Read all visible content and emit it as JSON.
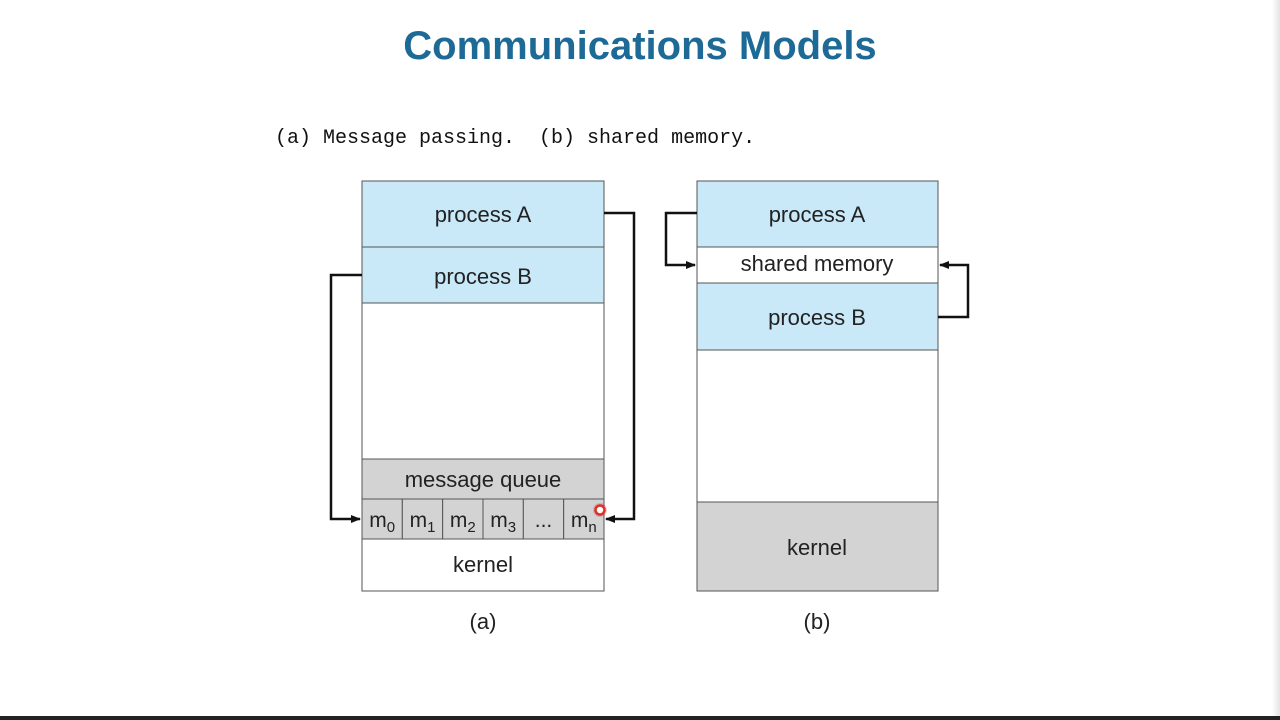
{
  "slide": {
    "title": "Communications Models",
    "subtitle": "(a) Message passing.  (b) shared memory."
  },
  "diagram_a": {
    "caption": "(a)",
    "process_a": "process A",
    "process_b": "process B",
    "queue_label": "message queue",
    "queue_slots": [
      {
        "base": "m",
        "sub": "0"
      },
      {
        "base": "m",
        "sub": "1"
      },
      {
        "base": "m",
        "sub": "2"
      },
      {
        "base": "m",
        "sub": "3"
      },
      {
        "base": "...",
        "sub": ""
      },
      {
        "base": "m",
        "sub": "n"
      }
    ],
    "kernel": "kernel"
  },
  "diagram_b": {
    "caption": "(b)",
    "process_a": "process A",
    "shared_memory": "shared memory",
    "process_b": "process B",
    "kernel": "kernel"
  },
  "colors": {
    "process_fill": "#c9e9f8",
    "kernel_fill": "#d3d3d3",
    "title_color": "#1d6a96",
    "pointer_color": "#d9322b"
  }
}
